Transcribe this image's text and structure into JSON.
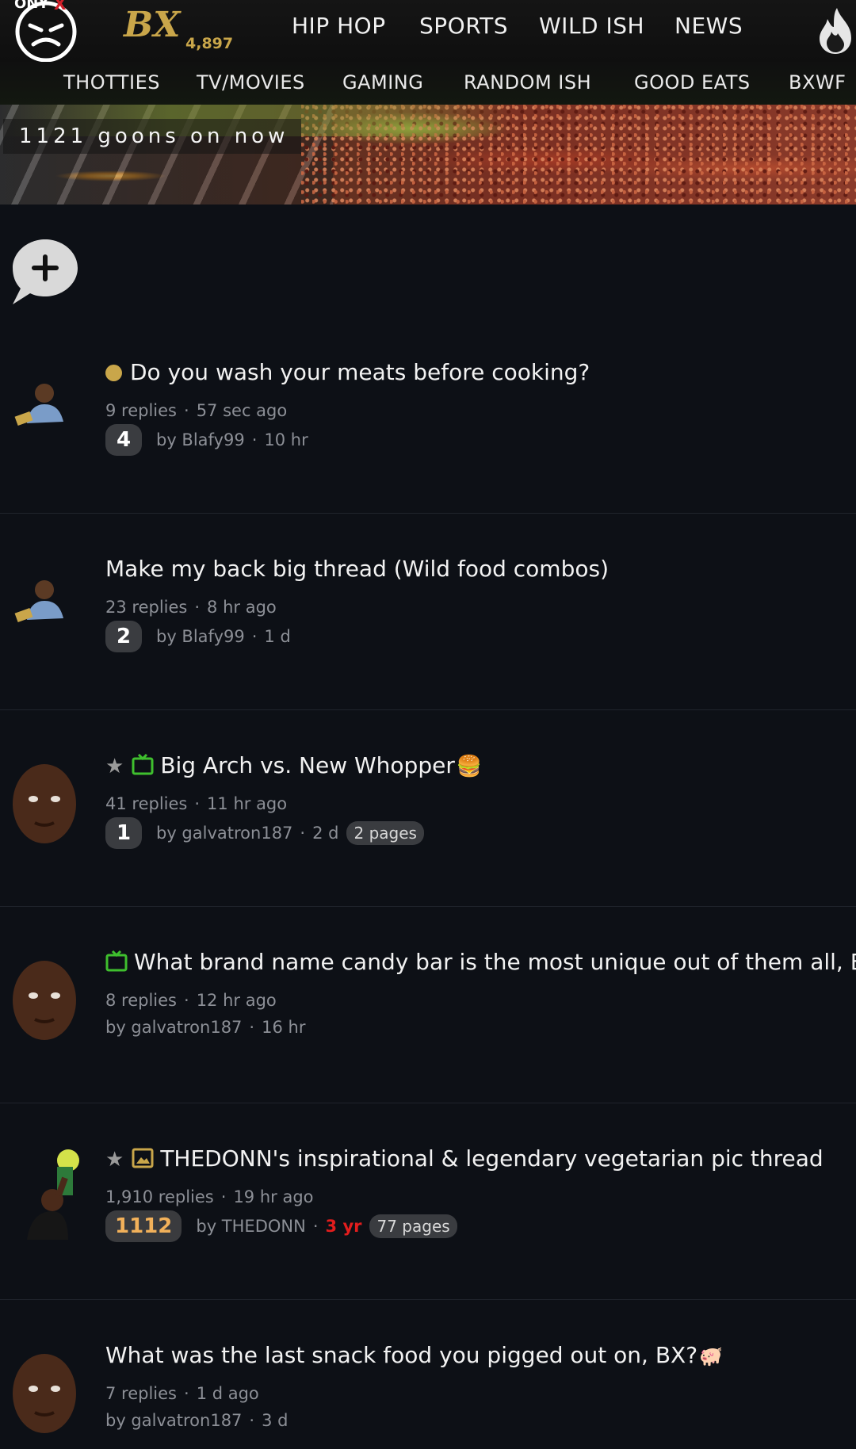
{
  "header": {
    "brand": "BX",
    "brand_count": "4,897",
    "nav_main": [
      "HIP HOP",
      "SPORTS",
      "WILD ISH",
      "NEWS"
    ],
    "nav_sub": [
      "THOTTIES",
      "TV/MOVIES",
      "GAMING",
      "RANDOM ISH",
      "GOOD EATS",
      "BXWF"
    ]
  },
  "banner": {
    "online_text": "1121 goons on now"
  },
  "threads": [
    {
      "title": "Do you wash your meats before cooking?",
      "replies": "9 replies",
      "last": "57 sec ago",
      "unread": "4",
      "author": "by Blafy99",
      "age": "10 hr"
    },
    {
      "title": "Make my back big thread (Wild food combos)",
      "replies": "23 replies",
      "last": "8 hr ago",
      "unread": "2",
      "author": "by Blafy99",
      "age": "1 d"
    },
    {
      "title": "Big Arch vs. New Whopper",
      "replies": "41 replies",
      "last": "11 hr ago",
      "unread": "1",
      "author": "by galvatron187",
      "age": "2 d",
      "pages": "2 pages"
    },
    {
      "title": "What brand name candy bar is the most unique out of them all, BX?",
      "replies": "8 replies",
      "last": "12 hr ago",
      "author": "by galvatron187",
      "age": "16 hr"
    },
    {
      "title": "THEDONN's inspirational & legendary vegetarian pic thread",
      "replies": "1,910 replies",
      "last": "19 hr ago",
      "unread": "1112",
      "author": "by THEDONN",
      "age": "3 yr",
      "pages": "77 pages"
    },
    {
      "title": "What was the last snack food you pigged out on, BX?",
      "replies": "7 replies",
      "last": "1 d ago",
      "author": "by galvatron187",
      "age": "3 d"
    }
  ],
  "colors": {
    "background": "#0d1016",
    "brand_gold": "#c9a64a",
    "unread_hot": "#f2b15a",
    "age_red": "#e21d1d",
    "media_green": "#3fbf2e"
  },
  "icons": [
    "onyx-logo-icon",
    "bx-logo-icon",
    "fire-icon",
    "new-thread-icon",
    "tv-icon",
    "picture-icon",
    "burger-emoji-icon",
    "pig-emoji-icon"
  ]
}
